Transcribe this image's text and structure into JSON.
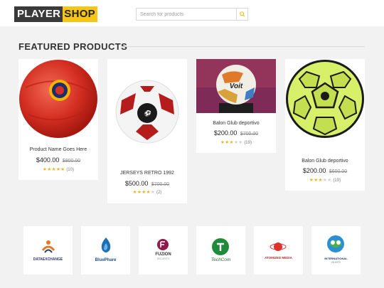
{
  "header": {
    "logo_part1": "PLAYER",
    "logo_part2": "SHOP",
    "search_placeholder": "Search for products"
  },
  "section": {
    "title": "FEATURED PRODUCTS"
  },
  "products": [
    {
      "name": "Product Name Goes Here",
      "price": "$400.00",
      "old_price": "$800.00",
      "rating": 5,
      "reviews": "(10)"
    },
    {
      "name": "JERSEYS RETRO 1992",
      "price": "$500.00",
      "old_price": "$700.00",
      "rating": 4.5,
      "reviews": "(2)"
    },
    {
      "name": "Balon Glub deportivo",
      "price": "$200.00",
      "old_price": "$700.00",
      "rating": 3.5,
      "reviews": "(19)",
      "image_text": "Voit"
    },
    {
      "name": "Balon Glub deportivo",
      "price": "$200.00",
      "old_price": "$600.00",
      "rating": 3.5,
      "reviews": "(19)"
    }
  ],
  "brands": [
    {
      "name": "DATAEXCHANGE"
    },
    {
      "name": "BluePhare"
    },
    {
      "name": "FUZION",
      "tagline": "SECURITY"
    },
    {
      "name": "TechCom"
    },
    {
      "name": "ATOMIZED MEDIA"
    },
    {
      "name": "INTERNATIONAL",
      "tagline": "HEARTS"
    }
  ],
  "colors": {
    "accent": "#f5c518",
    "dark": "#3a3a3a",
    "star": "#f2b01e"
  }
}
